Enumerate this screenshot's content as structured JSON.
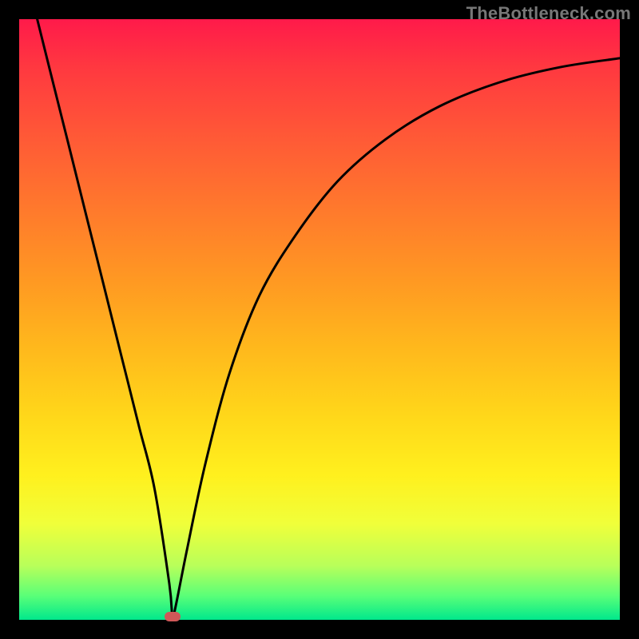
{
  "watermark": "TheBottleneck.com",
  "colors": {
    "background": "#000000",
    "marker": "#d05858",
    "curve": "#000000"
  },
  "chart_data": {
    "type": "line",
    "title": "",
    "xlabel": "",
    "ylabel": "",
    "xlim": [
      0,
      100
    ],
    "ylim": [
      0,
      100
    ],
    "grid": false,
    "series": [
      {
        "name": "bottleneck-curve",
        "x": [
          3,
          5,
          8,
          11,
          14,
          17,
          20,
          22.5,
          25,
          25.5,
          26,
          28,
          31,
          35,
          40,
          46,
          53,
          61,
          70,
          80,
          90,
          100
        ],
        "y": [
          100,
          92,
          80,
          68,
          56,
          44,
          32,
          22,
          6,
          0.5,
          2,
          12,
          26,
          41,
          54,
          64,
          73,
          80,
          85.5,
          89.5,
          92,
          93.5
        ]
      }
    ],
    "annotations": [
      {
        "name": "marker",
        "x": 25.5,
        "y": 0.5
      }
    ]
  }
}
